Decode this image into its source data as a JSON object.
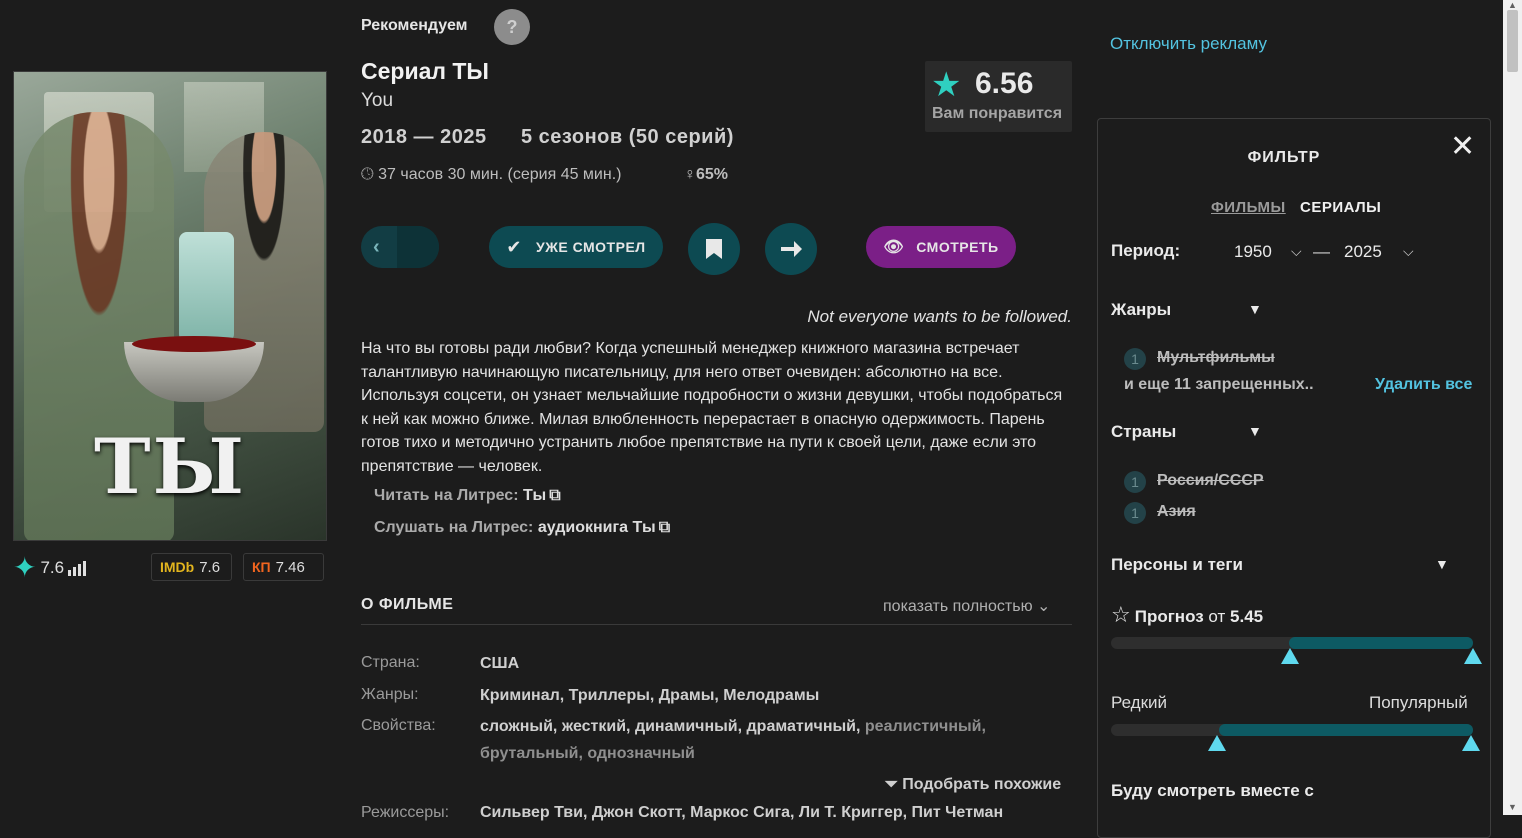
{
  "recommend": {
    "label": "Рекомендуем",
    "help": "?"
  },
  "title": {
    "ru": "Сериал ТЫ",
    "en": "You"
  },
  "meta": {
    "years": "2018 — 2025",
    "seasons": "5 сезонов (50 серий)",
    "duration": "37 часов 30 мин. (серия 45 мин.)",
    "female_share": "65%"
  },
  "forecast": {
    "value": "6.56",
    "label": "Вам понравится"
  },
  "poster": {
    "title": "ТЫ"
  },
  "ratings": {
    "own": "7.6",
    "imdb_label": "IMDb",
    "imdb": "7.6",
    "kp_label": "КП",
    "kp": "7.46"
  },
  "buttons": {
    "watched": "УЖЕ СМОТРЕЛ",
    "watch": "СМОТРЕТЬ"
  },
  "tagline": "Not everyone wants to be followed.",
  "description": "На что вы готовы ради любви? Когда успешный менеджер книжного магазина встречает талантливую начинающую писательницу, для него ответ очевиден: абсолютно на все. Используя соцсети, он узнает мельчайшие подробности о жизни девушки, чтобы подобраться к ней как можно ближе. Милая влюбленность перерастает в опасную одержимость. Парень готов тихо и методично устранить любое препятствие на пути к своей цели, даже если это препятствие — человек.",
  "litres": {
    "read_label": "Читать на Литрес:",
    "read_value": "Ты",
    "listen_label": "Слушать на Литрес:",
    "listen_value": "аудиокнига Ты"
  },
  "about": {
    "heading": "О ФИЛЬМЕ",
    "show_full": "показать полностью",
    "country_label": "Страна:",
    "country": "США",
    "genres_label": "Жанры:",
    "genres": "Криминал,  Триллеры,  Драмы,  Мелодрамы",
    "props_label": "Свойства:",
    "props_main": "сложный,  жесткий,  динамичный,  драматичный,",
    "props_dim1": "реалистичный,",
    "props_dim2": "брутальный,  однозначный",
    "similar": "Подобрать похожие",
    "directors_label": "Режиссеры:",
    "directors": "Сильвер Тви,  Джон Скотт,  Маркос Сига,  Ли Т. Криггер,  Пит Четман"
  },
  "no_ads": "Отключить рекламу",
  "filter": {
    "title": "ФИЛЬТР",
    "tab_films": "ФИЛЬМЫ",
    "tab_series": "СЕРИАЛЫ",
    "period_label": "Период:",
    "year_from": "1950",
    "year_to": "2025",
    "dash": "—",
    "genres_label": "Жанры",
    "genre_count": "1",
    "genre_excluded": "Мультфильмы",
    "genres_more": "и еще 11 запрещенных..",
    "delete_all": "Удалить все",
    "countries_label": "Страны",
    "country1_count": "1",
    "country1": "Россия/СССР",
    "country2_count": "1",
    "country2": "Азия",
    "persons_label": "Персоны и теги",
    "forecast_label": "Прогноз",
    "forecast_from": "от",
    "forecast_value": "5.45",
    "rare": "Редкий",
    "popular": "Популярный",
    "watch_with": "Буду смотреть вместе с"
  }
}
